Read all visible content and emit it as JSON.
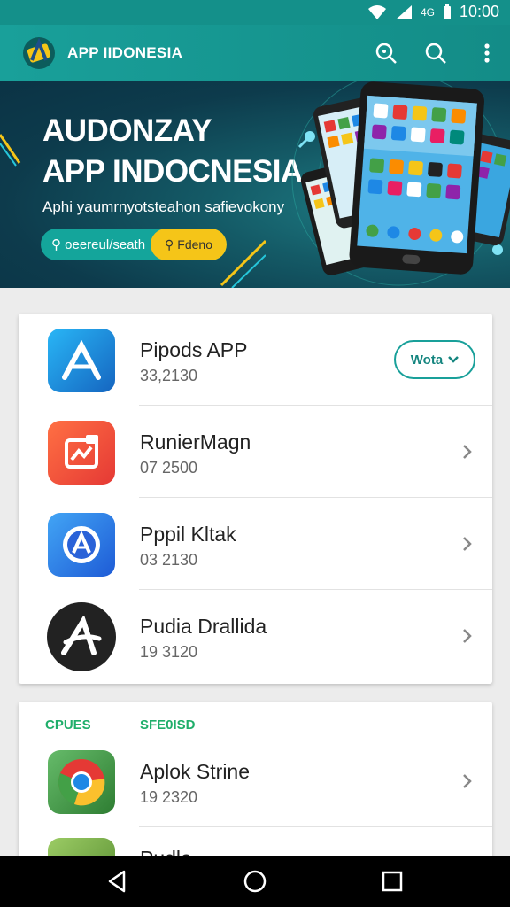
{
  "status_bar": {
    "time": "10:00",
    "signal_text": "4G",
    "icons": [
      "wifi-icon",
      "signal-icon",
      "battery-icon"
    ]
  },
  "app_bar": {
    "title": "APP IIDONESIA",
    "actions": [
      "search-icon",
      "search-icon",
      "more-vert-icon"
    ]
  },
  "hero": {
    "title_line1": "AUDONZAY",
    "title_line2": "APP INDOCNESIA",
    "subtitle": "Aphi yaumrnyotsteahon safievokony",
    "pill_left": "oeereul/seath",
    "pill_right": "Fdeno"
  },
  "featured": {
    "items": [
      {
        "name": "Pipods APP",
        "meta": "33,2130",
        "icon": "app-store-icon",
        "action": "Wota"
      },
      {
        "name": "RunierMagn",
        "meta": "07 2500",
        "icon": "chart-app-icon"
      },
      {
        "name": "Pppil Kltak",
        "meta": "03 2130",
        "icon": "badge-app-icon"
      },
      {
        "name": "Pudia Drallida",
        "meta": "19 3120",
        "icon": "a-logo-app-icon"
      }
    ]
  },
  "section2": {
    "label_left": "CPUES",
    "label_right": "SFE0ISD",
    "items": [
      {
        "name": "Aplok Strine",
        "meta": "19 2320",
        "icon": "chrome-icon"
      },
      {
        "name": "Pudla",
        "meta": "",
        "icon": "green-app-icon"
      }
    ]
  },
  "nav": [
    "back-icon",
    "home-icon",
    "recents-icon"
  ],
  "colors": {
    "primary": "#19a09a",
    "accent": "#f5c518",
    "hero_bg": "#0d3b4c",
    "section_label": "#1fae6a"
  }
}
